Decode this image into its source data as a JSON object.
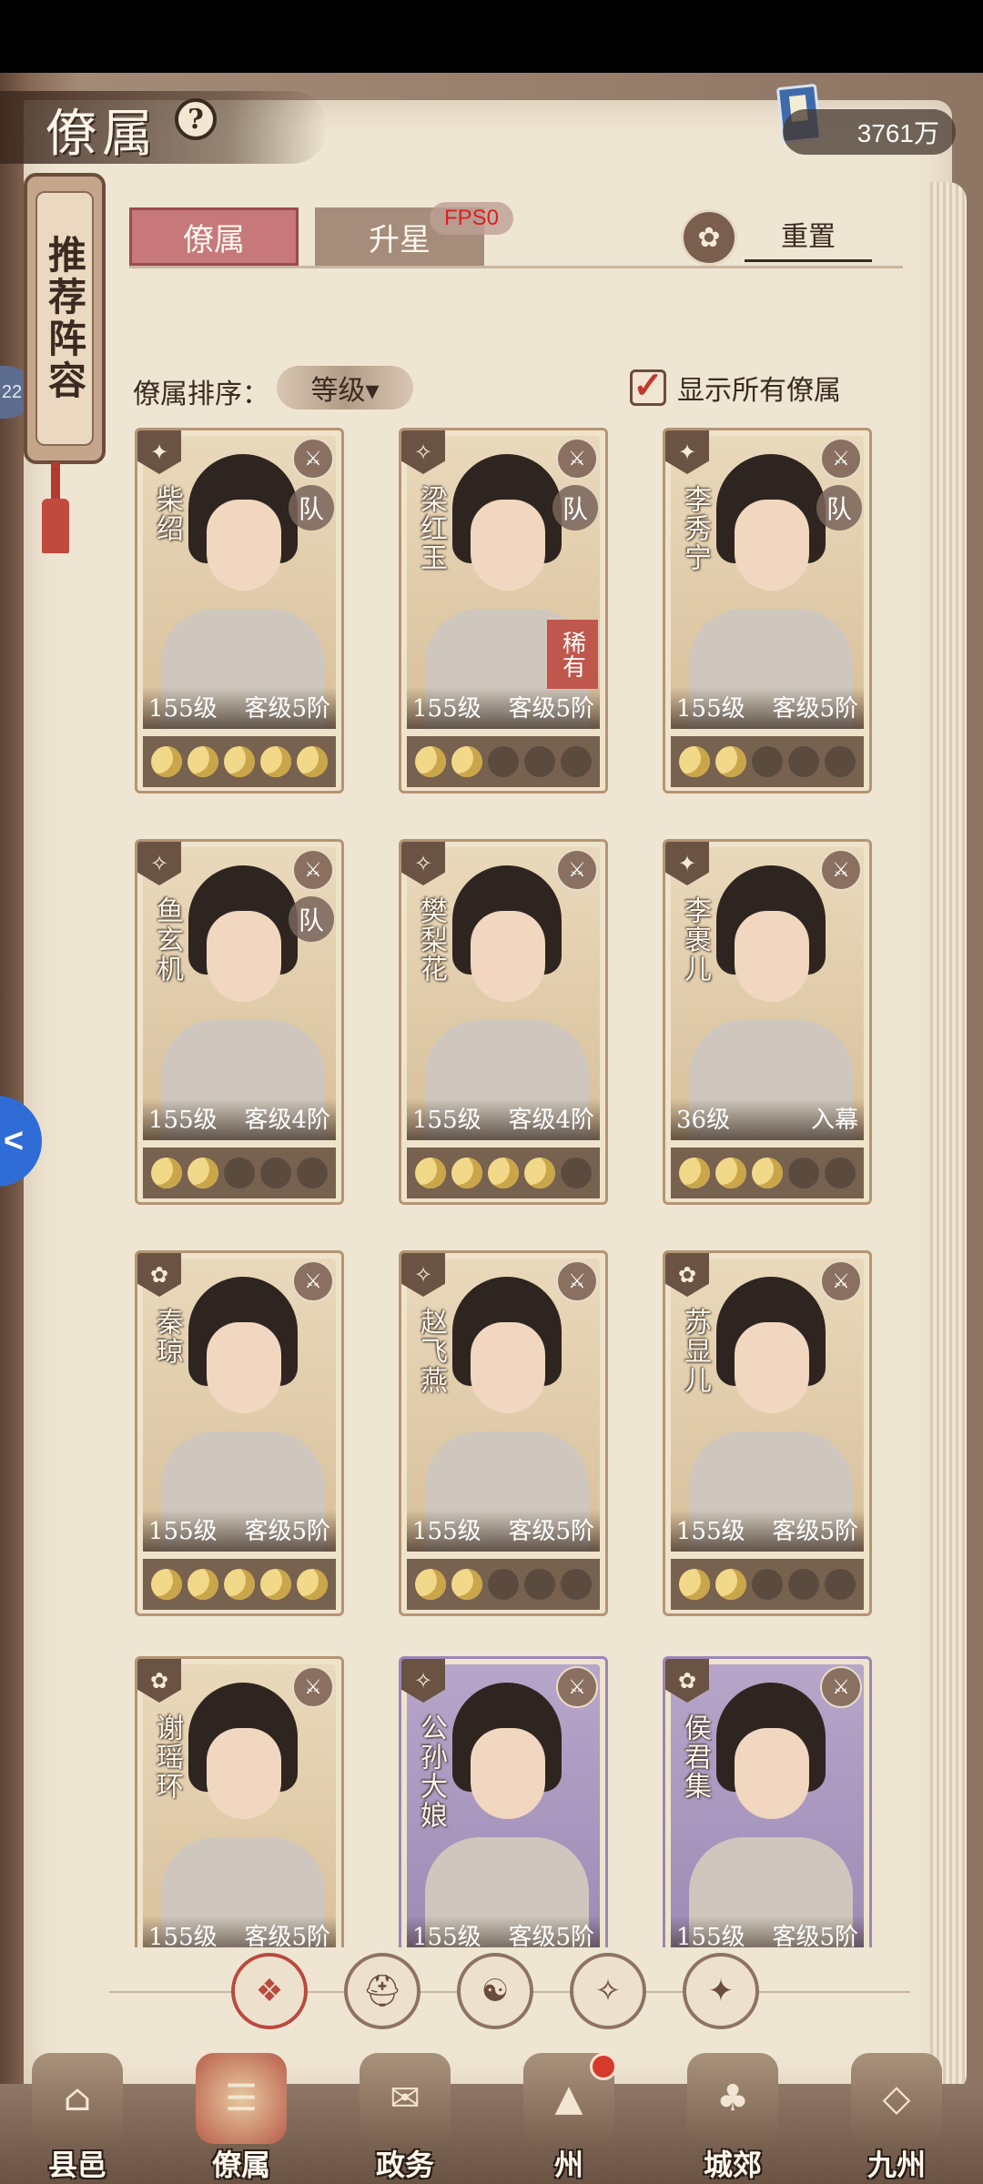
{
  "header": {
    "title": "僚属",
    "help_icon": "?",
    "currency_value": "3761万",
    "currency_icon": "book-icon"
  },
  "side": {
    "recommend_label": "推荐阵容",
    "badge_text": "22",
    "float_button": "<"
  },
  "tabs": [
    {
      "label": "僚属",
      "active": true
    },
    {
      "label": "升星",
      "active": false
    }
  ],
  "fps": "FPS0",
  "reset": {
    "label": "重置",
    "icon": "reset-icon"
  },
  "sort": {
    "label": "僚属排序：",
    "value": "等级▾"
  },
  "show_all": {
    "checked": true,
    "check_glyph": "✓",
    "label": "显示所有僚属"
  },
  "cards": [
    {
      "name": "柴绍",
      "level": "155级",
      "rank": "客级5阶",
      "stars": 5,
      "team": "队",
      "rare": "",
      "type_icon": "✦",
      "color": "gold"
    },
    {
      "name": "梁红玉",
      "level": "155级",
      "rank": "客级5阶",
      "stars": 2,
      "team": "队",
      "rare": "稀有",
      "type_icon": "✧",
      "color": "gold"
    },
    {
      "name": "李秀宁",
      "level": "155级",
      "rank": "客级5阶",
      "stars": 2,
      "team": "队",
      "rare": "",
      "type_icon": "✦",
      "color": "gold"
    },
    {
      "name": "鱼玄机",
      "level": "155级",
      "rank": "客级4阶",
      "stars": 2,
      "team": "队",
      "rare": "",
      "type_icon": "✧",
      "color": "gold"
    },
    {
      "name": "樊梨花",
      "level": "155级",
      "rank": "客级4阶",
      "stars": 4,
      "team": "",
      "rare": "",
      "type_icon": "✧",
      "color": "gold"
    },
    {
      "name": "李裹儿",
      "level": "36级",
      "rank": "入幕",
      "stars": 3,
      "team": "",
      "rare": "",
      "type_icon": "✦",
      "color": "gold"
    },
    {
      "name": "秦琼",
      "level": "155级",
      "rank": "客级5阶",
      "stars": 5,
      "team": "",
      "rare": "",
      "type_icon": "✿",
      "color": "gold"
    },
    {
      "name": "赵飞燕",
      "level": "155级",
      "rank": "客级5阶",
      "stars": 2,
      "team": "",
      "rare": "",
      "type_icon": "✧",
      "color": "gold"
    },
    {
      "name": "苏显儿",
      "level": "155级",
      "rank": "客级5阶",
      "stars": 2,
      "team": "",
      "rare": "",
      "type_icon": "✿",
      "color": "gold"
    },
    {
      "name": "谢瑶环",
      "level": "155级",
      "rank": "客级5阶",
      "stars": 0,
      "team": "",
      "rare": "",
      "type_icon": "✿",
      "color": "gold"
    },
    {
      "name": "公孙大娘",
      "level": "155级",
      "rank": "客级5阶",
      "stars": 0,
      "team": "",
      "rare": "",
      "type_icon": "✧",
      "color": "purple"
    },
    {
      "name": "侯君集",
      "level": "155级",
      "rank": "客级5阶",
      "stars": 0,
      "team": "",
      "rare": "",
      "type_icon": "✿",
      "color": "purple"
    }
  ],
  "filters": [
    {
      "icon": "all-icon",
      "glyph": "❖",
      "active": true
    },
    {
      "icon": "helmet-icon",
      "glyph": "⛑",
      "active": false
    },
    {
      "icon": "gourd-icon",
      "glyph": "☯",
      "active": false
    },
    {
      "icon": "fan-icon",
      "glyph": "✧",
      "active": false
    },
    {
      "icon": "beast-icon",
      "glyph": "✦",
      "active": false
    }
  ],
  "nav": [
    {
      "label": "县邑",
      "icon": "city-icon",
      "glyph": "⌂"
    },
    {
      "label": "僚属",
      "icon": "scroll-icon",
      "glyph": "☰",
      "active": true
    },
    {
      "label": "政务",
      "icon": "scroll-bundle-icon",
      "glyph": "✉"
    },
    {
      "label": "州",
      "icon": "mountain-icon",
      "glyph": "▲",
      "dot": true
    },
    {
      "label": "城郊",
      "icon": "tree-icon",
      "glyph": "♣"
    },
    {
      "label": "九州",
      "icon": "map-icon",
      "glyph": "◇"
    }
  ]
}
